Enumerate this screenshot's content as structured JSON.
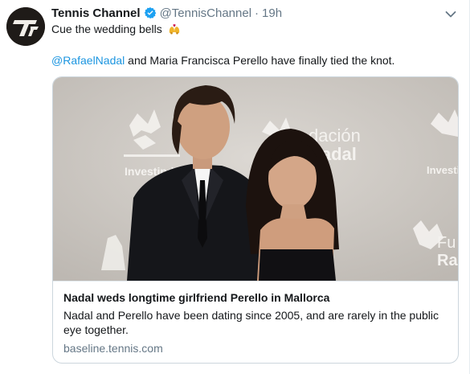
{
  "tweet": {
    "author_name": "Tennis Channel",
    "author_handle": "@TennisChannel",
    "separator": "·",
    "timestamp": "19h",
    "text_line1": "Cue the wedding bells",
    "emoji_icon": "wedding-bells-icon",
    "mention": "@RafaelNadal",
    "text_line2": " and Maria Francisca Perello have finally tied the knot."
  },
  "card": {
    "backdrop_text_center": "dación",
    "backdrop_text_center2": "Nadal",
    "backdrop_text_left": "Investind",
    "backdrop_text_right": "Investi",
    "backdrop_text_right2": "Fu",
    "backdrop_text_right3": "Raf",
    "title": "Nadal weds longtime girlfriend Perello in Mallorca",
    "description": "Nadal and Perello have been dating since 2005, and are rarely in the public eye together.",
    "domain": "baseline.tennis.com"
  },
  "colors": {
    "link": "#1b95e0",
    "verified": "#1da1f2",
    "secondary_text": "#657786",
    "backdrop": "#cfcbc6"
  }
}
